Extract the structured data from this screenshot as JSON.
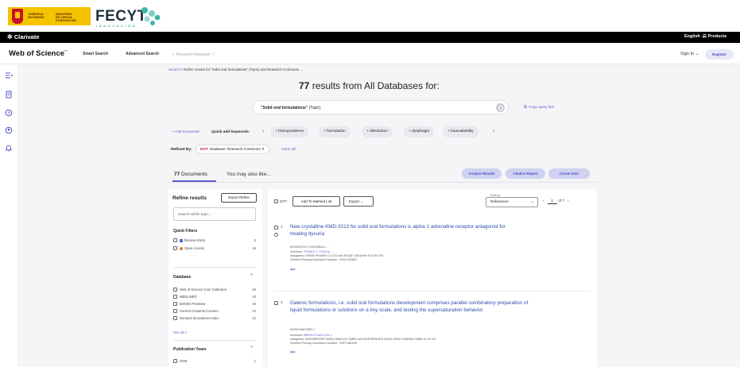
{
  "banner": {
    "gov_text_left": "GOBIERNO\nDE ESPAÑA",
    "gov_text_right": "MINISTERIO\nDE CIENCIA\nE INNOVACIÓN",
    "fecyt_word": "FECYT",
    "fecyt_sub": "INNOVACIÓN"
  },
  "topbar": {
    "brand": "Clarivate",
    "language": "English ⌄",
    "products": "Products"
  },
  "header": {
    "logo": "Web of Science",
    "logo_tm": "™",
    "nav": [
      "Smart Search",
      "Advanced Search",
      "Research Assistant"
    ],
    "sign_in": "Sign In ⌄",
    "register": "Register"
  },
  "breadcrumb": {
    "root": "Search",
    "sep": ">",
    "current": "Refine results for \"Solid oral formulations\" (Topic) and Research Commons ..."
  },
  "results": {
    "count": "77",
    "heading_rest": " results from All Databases for:"
  },
  "query": {
    "term": "\"Solid oral formulations\"",
    "field": " (Topic)",
    "copy_link": "Copy query link"
  },
  "keywords": {
    "add_label": "+ Add Keywords",
    "quick_label": "Quick add keywords:",
    "chips": [
      "+ bioequivalence",
      "+ formulation",
      "+ dissolution",
      "+ dysphagia",
      "+ bioavailability"
    ]
  },
  "refined": {
    "label": "Refined By:",
    "not": "NOT",
    "chip": "Database: Research Commons ✕",
    "clear_all": "Clear all"
  },
  "tabs": {
    "docs_count": "77",
    "docs_label": " Documents",
    "also": "You may also like..."
  },
  "actions": {
    "analyze": "Analyze Results",
    "citation": "Citation Report",
    "alert": "Create Alert"
  },
  "refine_panel": {
    "title": "Refine results",
    "export": "Export Refine",
    "search_placeholder": "Search within topic...",
    "quick_filters_title": "Quick Filters",
    "quick_filters": [
      {
        "label": "Review Article",
        "count": "5"
      },
      {
        "label": "Open Access",
        "count": "18"
      }
    ],
    "database_title": "Database",
    "databases": [
      {
        "label": "Web of Science Core Collection",
        "count": "40"
      },
      {
        "label": "MEDLINE®",
        "count": "43"
      },
      {
        "label": "BIOSIS Previews",
        "count": "40"
      },
      {
        "label": "Current Contents Connect",
        "count": "24"
      },
      {
        "label": "Derwent Innovations Index",
        "count": "12"
      }
    ],
    "see_all": "See all >",
    "pub_years_title": "Publication Years",
    "pub_years": [
      {
        "label": "2025",
        "count": "1"
      }
    ]
  },
  "results_panel": {
    "selected": "0/77",
    "add_marked": "Add To Marked List",
    "export": "Export ⌄",
    "sort_label": "Sort by",
    "sort_value": "Relevance",
    "pager_prev": "‹",
    "page": "1",
    "of": "of 7",
    "pager_next": "›",
    "records": [
      {
        "num": "1",
        "title": "New crystalline KMD-3213 for solid oral formulations is alpha 1 adrenaline receptor antagonist for treating dysuria",
        "authors": "MIYASHITA Y; KUSHIDA A; ...",
        "inventors": "TSUBOI T; TODA N; ...",
        "assignee": "KISSEI PHARM CO LTD and KISSEI YAKUHIN KOGYO KK",
        "accession": "Derwent Primary Accession Number : 2004-153822",
        "more": "•••"
      },
      {
        "num": "2",
        "title": "Galenic formulations, i.e. solid oral formulations development comprises parallel combinatory preparation of liquid formulations or solutions on a tiny scale, and testing the supersaturation behavior",
        "authors": "MOSCHWITZER J",
        "inventors": "BREHL R and KOH J",
        "assignee": "BOEHRINGER INGELHEIM INT GMBH and BOEHRINGER INGELHEIM PHARMA GMBH & CO KG",
        "accession": "Derwent Primary Accession Number : 2007-681925",
        "more": "•••"
      }
    ]
  },
  "colors": {
    "accent": "#5b5fc7",
    "title_link": "#2a4ea8",
    "background": "#f5f5f7",
    "topbar": "#000000",
    "action_button": "#cfd1f1"
  }
}
